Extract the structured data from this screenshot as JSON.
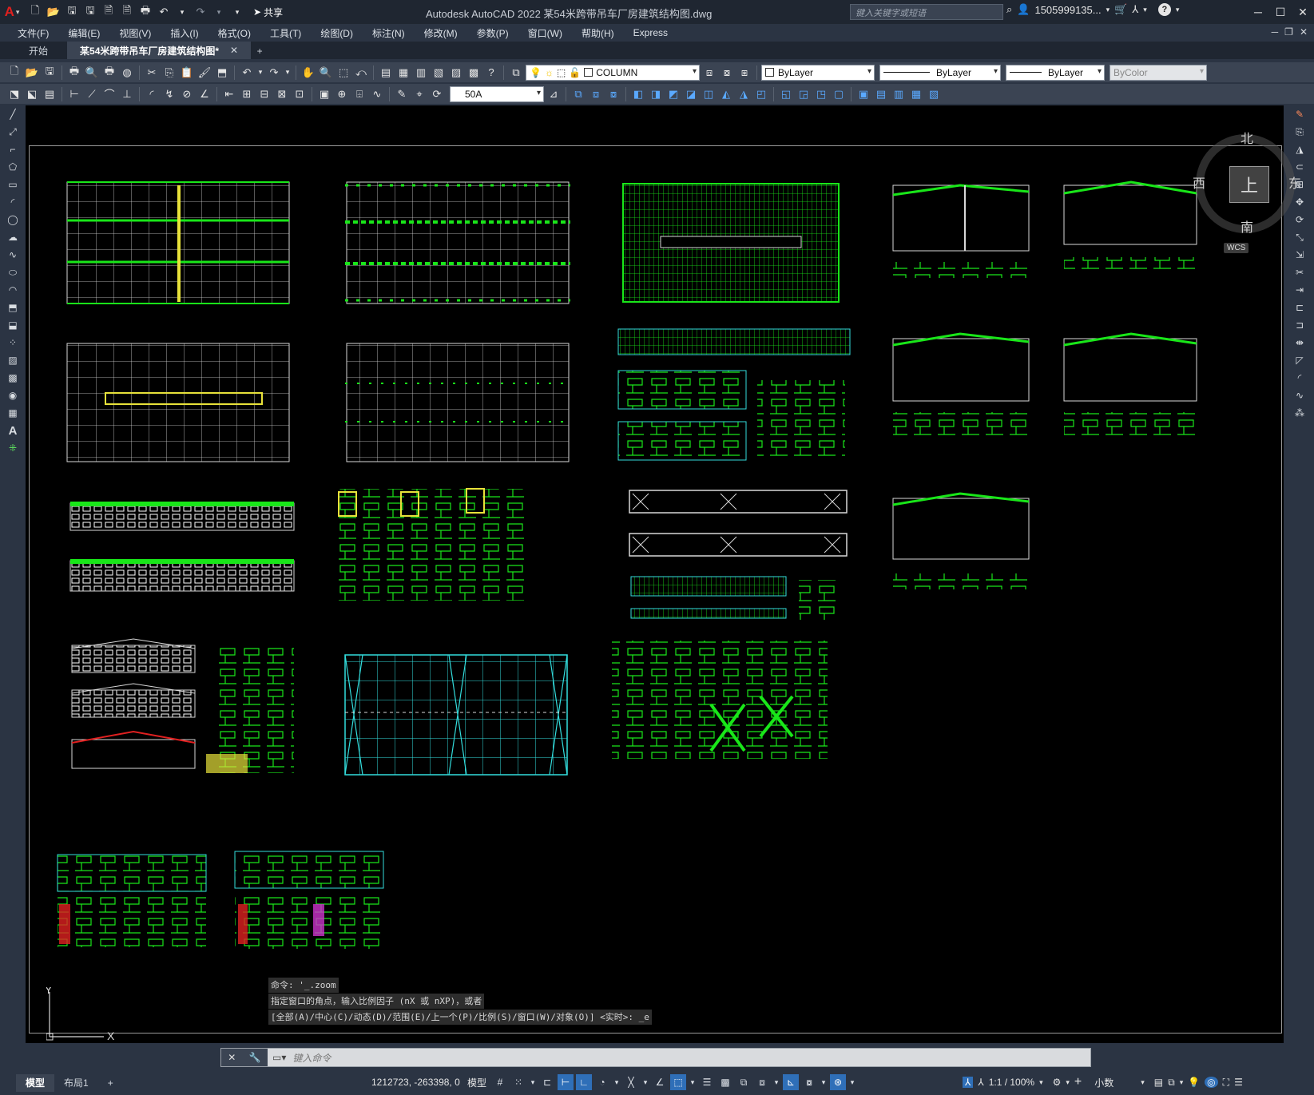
{
  "app": {
    "logo": "A",
    "title": "Autodesk AutoCAD 2022    某54米跨带吊车厂房建筑结构图.dwg",
    "search_placeholder": "键入关键字或短语",
    "user": "1505999135...",
    "share_label": "共享"
  },
  "menu": [
    "文件(F)",
    "编辑(E)",
    "视图(V)",
    "插入(I)",
    "格式(O)",
    "工具(T)",
    "绘图(D)",
    "标注(N)",
    "修改(M)",
    "参数(P)",
    "窗口(W)",
    "帮助(H)",
    "Express"
  ],
  "tabs": {
    "start": "开始",
    "drawing": "某54米跨带吊车厂房建筑结构图*",
    "close": "✕",
    "add": "+"
  },
  "properties": {
    "layer": "COLUMN",
    "color": "ByLayer",
    "linetype": "ByLayer",
    "lineweight": "ByLayer",
    "plotstyle": "ByColor",
    "dimstyle": "50A"
  },
  "viewcube": {
    "top": "上",
    "north": "北",
    "south": "南",
    "east": "东",
    "west": "西",
    "wcs": "WCS"
  },
  "command": {
    "history": [
      "命令: '_.zoom",
      "指定窗口的角点，输入比例因子 (nX 或 nXP)，或者",
      "[全部(A)/中心(C)/动态(D)/范围(E)/上一个(P)/比例(S)/窗口(W)/对象(O)] <实时>: _e"
    ],
    "placeholder": "键入命令"
  },
  "status": {
    "model_tab": "模型",
    "layout_tab": "布局1",
    "add": "+",
    "coords": "1212723, -263398, 0",
    "space": "模型",
    "scale": "1:1 / 100%",
    "units": "小数"
  },
  "colors": {
    "canvas": "#000000",
    "drawing_green": "#19e619",
    "drawing_cyan": "#33dddd",
    "drawing_yellow": "#e8e23a",
    "drawing_red": "#e02020",
    "accent_blue": "#2f6fb8"
  }
}
